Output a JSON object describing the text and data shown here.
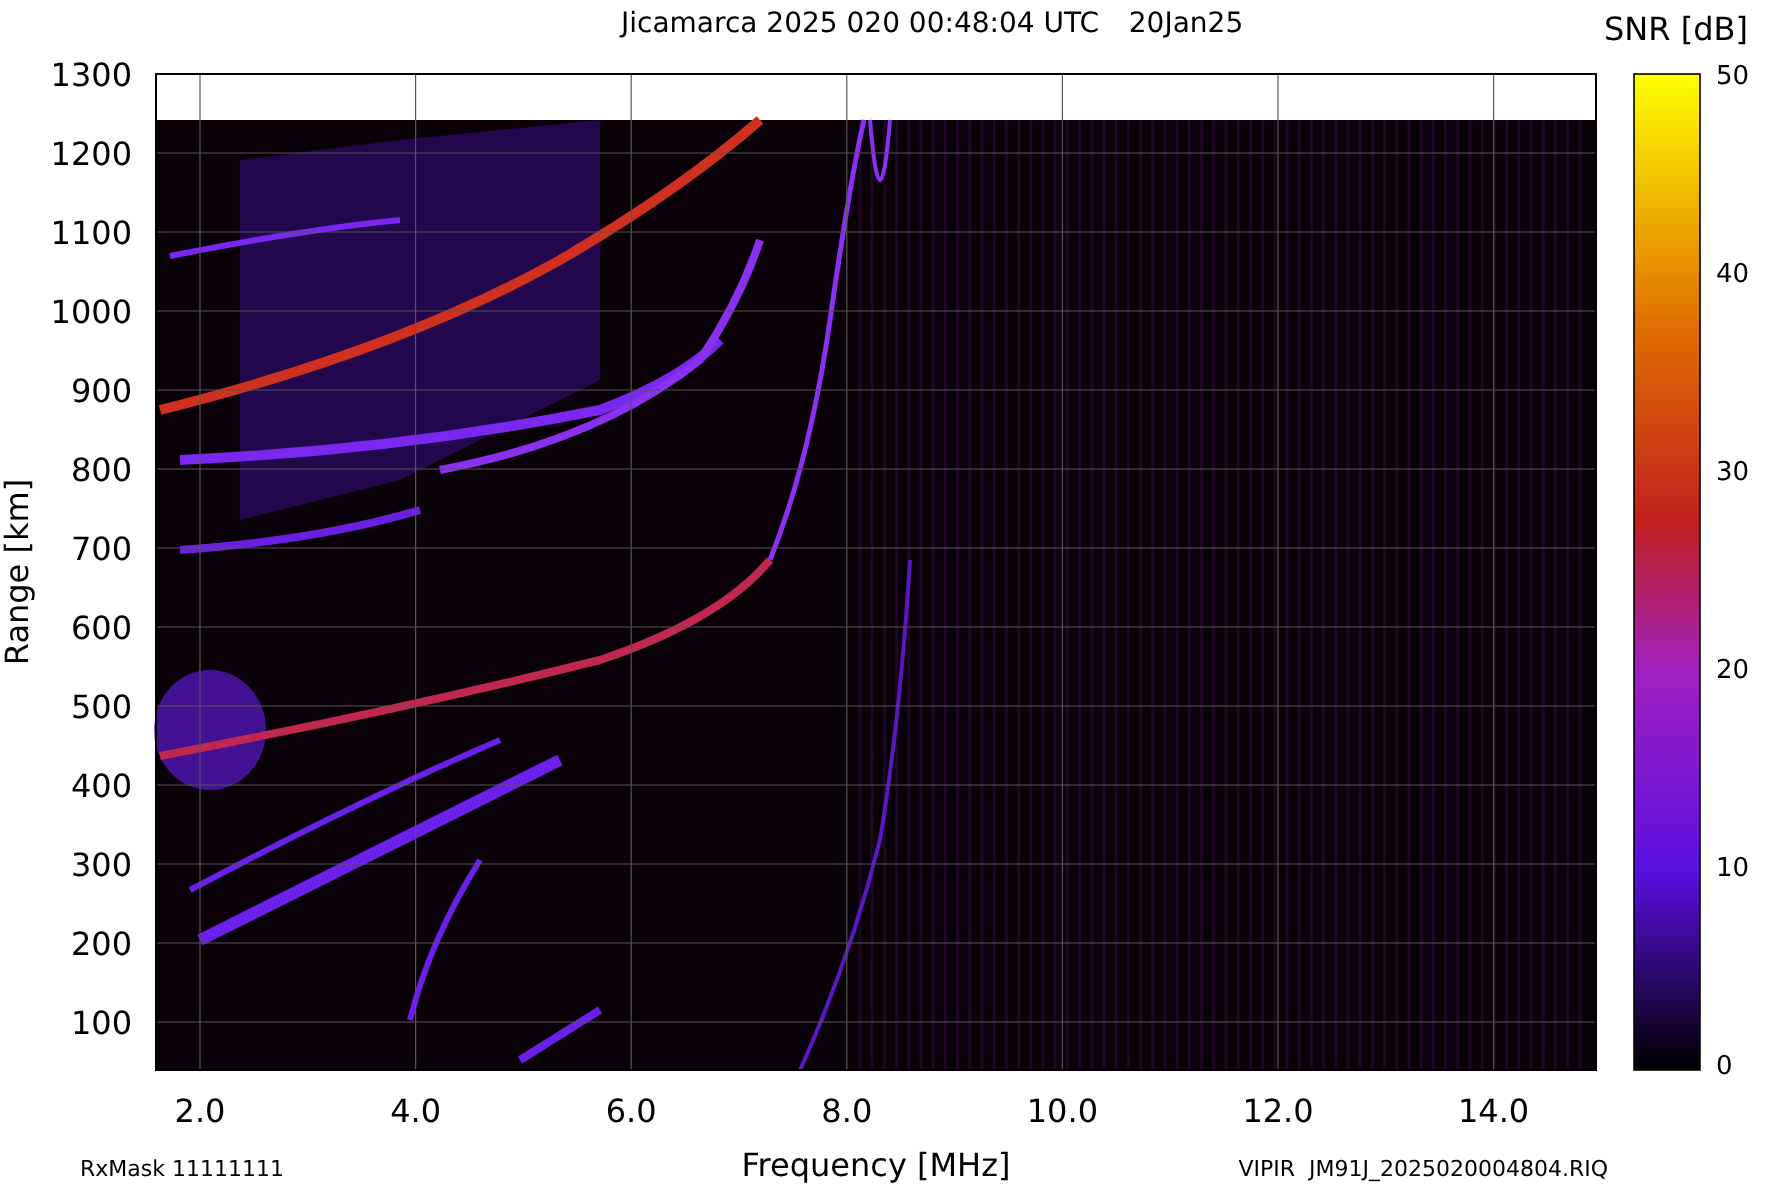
{
  "title": "Jicamarca 2025 020 00:48:04 UTC",
  "date": "20Jan25",
  "colorbar": {
    "title": "SNR [dB]",
    "ticks": [
      "50",
      "40",
      "30",
      "20",
      "10",
      "0"
    ]
  },
  "plot": {
    "ylabel": "Range [km]",
    "xlabel": "Frequency [MHz]",
    "yticks": [
      "1300",
      "1200",
      "1100",
      "1000",
      "900",
      "800",
      "700",
      "600",
      "500",
      "400",
      "300",
      "200",
      "100"
    ],
    "xticks": [
      "2.0",
      "4.0",
      "6.0",
      "8.0",
      "10.0",
      "12.0",
      "14.0"
    ]
  },
  "footer_left": "RxMask 11111111",
  "footer_right": "VIPIR  JM91J_2025020004804.RIQ"
}
